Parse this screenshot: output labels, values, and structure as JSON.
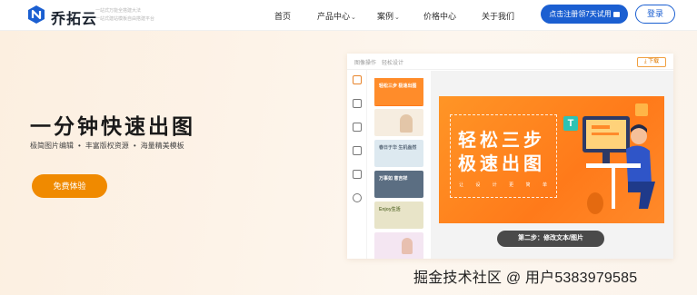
{
  "header": {
    "brand": "乔拓云",
    "tagline": [
      "一站式万能全搭建大法",
      "一站式建站模板自由搭建平台"
    ],
    "nav": [
      {
        "label": "首页",
        "has_dropdown": false
      },
      {
        "label": "产品中心",
        "has_dropdown": true
      },
      {
        "label": "案例",
        "has_dropdown": true
      },
      {
        "label": "价格中心",
        "has_dropdown": false
      },
      {
        "label": "关于我们",
        "has_dropdown": false
      }
    ],
    "trial_button": "点击注册领7天试用",
    "login_button": "登录",
    "colors": {
      "primary": "#1b5fd1"
    }
  },
  "hero": {
    "title": "一分钟快速出图",
    "features": [
      "极简图片编辑",
      "丰富版权资源",
      "海量精美模板"
    ],
    "cta": "免费体验",
    "colors": {
      "cta": "#f08a00"
    }
  },
  "editor": {
    "breadcrumb": [
      "图像操作",
      "轻松设计"
    ],
    "download_button": "下载",
    "tools": [
      "template-icon",
      "text-icon",
      "image-icon",
      "material-icon",
      "background-icon",
      "upload-icon"
    ],
    "thumbnails": [
      {
        "text": "轻松三步 极速出图",
        "bg": "#ff8c2a",
        "fg": "#ffffff"
      },
      {
        "text": "",
        "bg": "#f6ede0",
        "fg": "#333333"
      },
      {
        "text": "春日于华 生机盎然",
        "bg": "#dde9f0",
        "fg": "#5a6a7a"
      },
      {
        "text": "万事如 意吉祥",
        "bg": "#5b6e82",
        "fg": "#ffffff"
      },
      {
        "text": "Enjoy生活",
        "bg": "#e8e4c8",
        "fg": "#6a7a40"
      },
      {
        "text": "",
        "bg": "#f4e6f2",
        "fg": "#b04a9a"
      }
    ],
    "poster": {
      "line1": "轻松三步",
      "line2": "极速出图",
      "caption": "让 设 计 更 简 单"
    },
    "step_label": "第二步：修改文本/图片"
  },
  "watermark": "掘金技术社区 @ 用户5383979585"
}
